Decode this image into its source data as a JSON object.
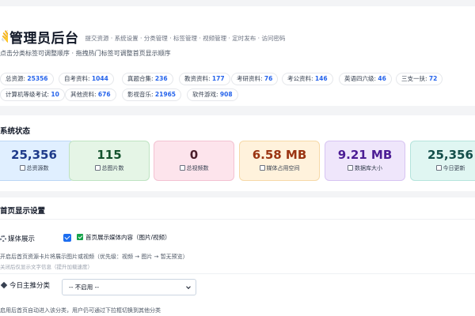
{
  "header": {
    "title_emoji": "👋",
    "title": "管理员后台",
    "description": "提交资源 · 系统设置 · 分类管理 · 标签管理 · 视频管理 · 定时发布 · 访问密码",
    "hint": "点击分类标签可调整顺序 · 拖拽热门标签可调整首页显示顺序"
  },
  "category_tags": [
    {
      "label": "总资源:",
      "count": "25356"
    },
    {
      "label": "自考资料:",
      "count": "1044"
    },
    {
      "label": "真题合集:",
      "count": "236"
    },
    {
      "label": "教资资料:",
      "count": "177"
    },
    {
      "label": "考研资料:",
      "count": "76"
    },
    {
      "label": "考公资料:",
      "count": "146"
    },
    {
      "label": "英语四六级:",
      "count": "46"
    },
    {
      "label": "三支一扶:",
      "count": "72"
    },
    {
      "label": "计算机等级考试:",
      "count": "10"
    },
    {
      "label": "其他资料:",
      "count": "676"
    },
    {
      "label": "影视音乐:",
      "count": "21965"
    },
    {
      "label": "软件游戏:",
      "count": "908"
    }
  ],
  "system_status": {
    "title": "系统状态",
    "stats": [
      {
        "value": "25,356",
        "label": "总资源数",
        "color": "#1e3a8a",
        "bg": "#e0efff",
        "border": "#bcd7f5"
      },
      {
        "value": "115",
        "label": "总图片数",
        "color": "#14532d",
        "bg": "#e5f5e6",
        "border": "#bfe3c2"
      },
      {
        "value": "0",
        "label": "总视频数",
        "color": "#4a1d2a",
        "bg": "#fde4ec",
        "border": "#f3c2d2"
      },
      {
        "value": "6.58 MB",
        "label": "媒体占用空间",
        "color": "#9a3412",
        "bg": "#fff2dc",
        "border": "#f6d9a8"
      },
      {
        "value": "9.21 MB",
        "label": "数据库大小",
        "color": "#4c1d95",
        "bg": "#efe6fb",
        "border": "#d7c4f2"
      },
      {
        "value": "25,356",
        "label": "今日更新",
        "color": "#134e4a",
        "bg": "#e0f6f2",
        "border": "#b5e4dc"
      }
    ]
  },
  "home_display": {
    "title": "首页显示设置",
    "media_label": "媒体展示",
    "media_checkbox_text": "首页展示媒体内容（图片/视频）",
    "media_note": "开启后首页资源卡片将展示图片或视频（优先级：视频 → 图片 → 暂无预览）",
    "media_subnote": "关闭后仅显示文字信息（提升加载速度）",
    "main_category_label": "今日主推分类",
    "main_category_select": "-- 不启用 --",
    "main_category_note": "启用后首页自动进入该分类，用户仍可通过下拉框切换到其他分类"
  }
}
